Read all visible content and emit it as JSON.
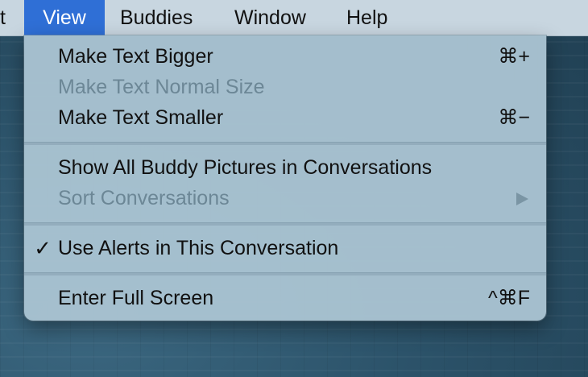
{
  "menubar": {
    "items": [
      {
        "label": "t"
      },
      {
        "label": "View"
      },
      {
        "label": "Buddies"
      },
      {
        "label": "Window"
      },
      {
        "label": "Help"
      }
    ],
    "active_item": "View"
  },
  "view_menu": {
    "items": [
      {
        "label": "Make Text Bigger",
        "shortcut": "⌘+",
        "enabled": true
      },
      {
        "label": "Make Text Normal Size",
        "shortcut": "",
        "enabled": false
      },
      {
        "label": "Make Text Smaller",
        "shortcut": "⌘−",
        "enabled": true
      },
      {
        "label": "Show All Buddy Pictures in Conversations",
        "shortcut": "",
        "enabled": true
      },
      {
        "label": "Sort Conversations",
        "shortcut": "",
        "enabled": false,
        "submenu": true
      },
      {
        "label": "Use Alerts in This Conversation",
        "shortcut": "",
        "enabled": true,
        "checked": true,
        "check_mark": "✓"
      },
      {
        "label": "Enter Full Screen",
        "shortcut": "^⌘F",
        "enabled": true
      }
    ]
  },
  "colors": {
    "menubar_bg": "#c8d6e0",
    "active_menu_bg": "#2f6fd6",
    "menu_bg": "#a8c2d1",
    "disabled_text": "#6c8796"
  }
}
